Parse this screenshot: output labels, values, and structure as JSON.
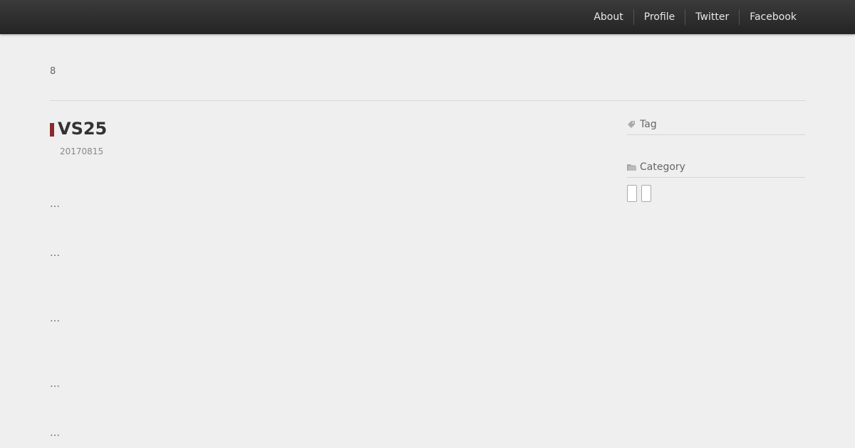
{
  "nav": {
    "items": [
      "About",
      "Profile",
      "Twitter",
      "Facebook"
    ]
  },
  "breadcrumb": "8",
  "post": {
    "title": "VS25",
    "date": "20170815",
    "paragraphs": [
      "…",
      "…",
      "…",
      "…",
      "…"
    ]
  },
  "sidebar": {
    "tag_heading": "Tag",
    "category_heading": "Category"
  },
  "colors": {
    "accent": "#8a2b2b",
    "topbar": "#2e2e2e",
    "background": "#efefef"
  }
}
